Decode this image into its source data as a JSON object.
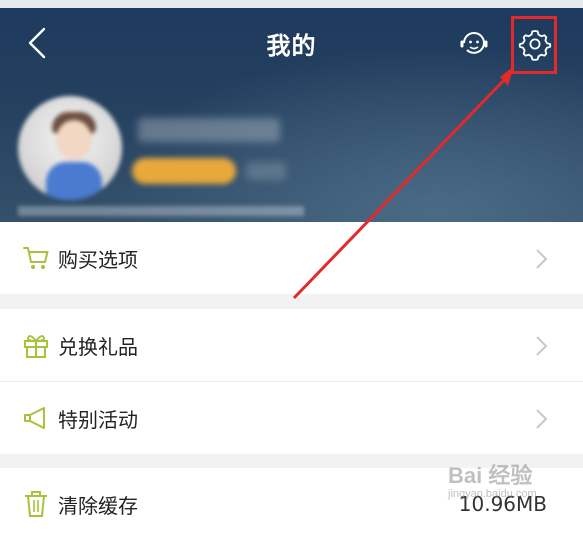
{
  "header": {
    "title": "我的",
    "icons": [
      "back-arrow-icon",
      "customer-service-icon",
      "gear-icon"
    ]
  },
  "menu": [
    {
      "label": "购买选项",
      "icon": "cart-icon"
    },
    {
      "label": "兑换礼品",
      "icon": "gift-icon"
    },
    {
      "label": "特别活动",
      "icon": "megaphone-icon"
    },
    {
      "label": "清除缓存",
      "icon": "trash-icon",
      "value": "10.96MB"
    }
  ],
  "watermark": {
    "text": "Bai 经验",
    "sub": "jingyan.baidu.com"
  },
  "colors": {
    "accent_icon": "#a6c33a",
    "highlight": "#e22a2a",
    "header_dark": "#1d3a5f"
  }
}
